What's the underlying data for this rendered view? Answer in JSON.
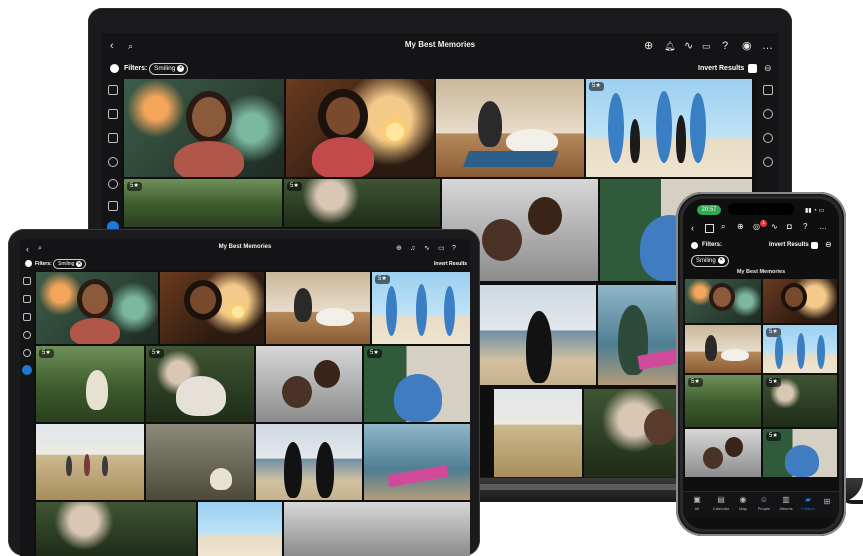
{
  "laptop": {
    "title": "My Best Memories",
    "filters_label": "Filters:",
    "filter_chip": "Smiling",
    "invert_results": "Invert Results",
    "badges": [
      "5★",
      "5★",
      "5★"
    ]
  },
  "tablet": {
    "title": "My Best Memories",
    "filters_label": "Filters:",
    "filter_chip": "Smiling",
    "invert_results": "Invert Results",
    "badges": [
      "5★",
      "5★",
      "5★",
      "5★"
    ]
  },
  "phone": {
    "time": "20:57",
    "title": "My Best Memories",
    "filters_label": "Filters:",
    "filter_chip": "Smiling",
    "invert_results": "Invert Results",
    "notification_count": "1",
    "badges": [
      "5★",
      "5★",
      "5★",
      "5★"
    ],
    "nav_items": [
      "All",
      "Calendar",
      "Map",
      "People",
      "Albums",
      "Folders"
    ]
  },
  "colors": {
    "accent": "#1e78d6",
    "background": "#0f0f10",
    "status_green": "#2eaa52"
  }
}
